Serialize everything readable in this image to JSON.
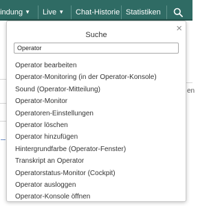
{
  "nav": {
    "items": [
      {
        "label": "bindung",
        "has_caret": true
      },
      {
        "label": "Live",
        "has_caret": true
      },
      {
        "label": "Chat-Historie",
        "has_caret": false
      },
      {
        "label": "Statistiken",
        "has_caret": false
      }
    ],
    "search_icon": "search-icon",
    "caret_glyph": "▼"
  },
  "background": {
    "right_fragment": "en"
  },
  "search_popup": {
    "title": "Suche",
    "close_glyph": "×",
    "query": "Operator",
    "results": [
      "Operator bearbeiten",
      "Operator-Monitoring (in der Operator-Konsole)",
      "Sound (Operator-Mitteilung)",
      "Operator-Monitor",
      "Operatoren-Einstellungen",
      "Operator löschen",
      "Operator hinzufügen",
      "Hintergrundfarbe (Operator-Fenster)",
      "Transkript an Operator",
      "Operatorstatus-Monitor (Cockpit)",
      "Operator ausloggen",
      "Operator-Konsole öffnen"
    ]
  },
  "colors": {
    "navbar": "#2f6b64",
    "text": "#333333"
  }
}
